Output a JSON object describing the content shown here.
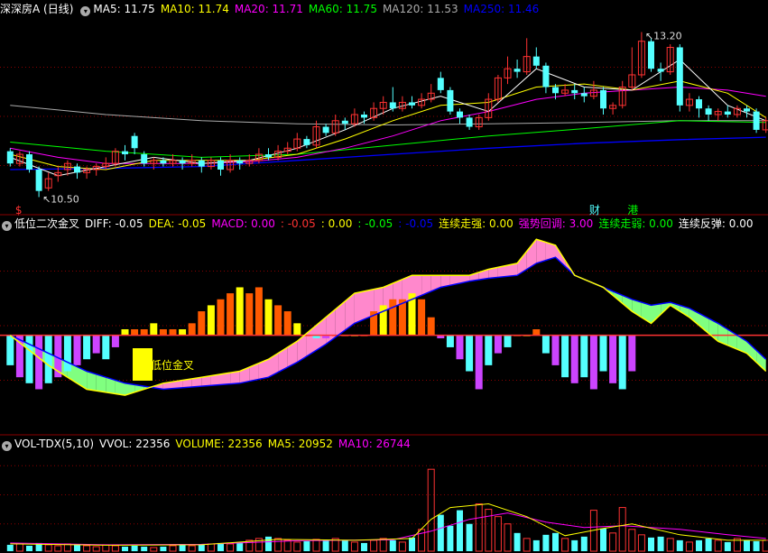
{
  "colors": {
    "bg": "#000000",
    "grid": "#8b0000",
    "up": "#ff3232",
    "down": "#54ffff",
    "ma5": "#ffffff",
    "ma10": "#ffff00",
    "ma20": "#ff00ff",
    "ma60": "#00ff00",
    "ma120": "#aaaaaa",
    "ma250": "#0000ff",
    "yellow": "#ffff00",
    "orange": "#ff5a00",
    "pink": "#ff88cc",
    "green": "#80ff80",
    "purple": "#cc44ff",
    "text_white": "#ffffff"
  },
  "panels": {
    "price": {
      "title": "深深房A (日线)",
      "indicators": [
        {
          "label": "MA5: 11.75",
          "color": "#ffffff"
        },
        {
          "label": "MA10: 11.74",
          "color": "#ffff00"
        },
        {
          "label": "MA20: 11.71",
          "color": "#ff00ff"
        },
        {
          "label": "MA60: 11.75",
          "color": "#00ff00"
        },
        {
          "label": "MA120: 11.53",
          "color": "#aaaaaa"
        },
        {
          "label": "MA250: 11.46",
          "color": "#0000ff"
        }
      ],
      "high_label": "13.20",
      "low_label": "10.50",
      "markers": [
        {
          "text": "$",
          "color": "#ff3232",
          "candle": 1
        },
        {
          "text": "财",
          "color": "#54ffff",
          "candle": 61
        },
        {
          "text": "港",
          "color": "#00ff00",
          "candle": 65
        }
      ]
    },
    "macd": {
      "title": "低位二次金叉",
      "indicators": [
        {
          "label": "DIFF: -0.05",
          "color": "#ffffff"
        },
        {
          "label": "DEA: -0.05",
          "color": "#ffff00"
        },
        {
          "label": "MACD: 0.00",
          "color": "#ff00ff"
        },
        {
          "label": ": -0.05",
          "color": "#ff3232"
        },
        {
          "label": ": 0.00",
          "color": "#ffff00"
        },
        {
          "label": ": -0.05",
          "color": "#00ff00"
        },
        {
          "label": ": -0.05",
          "color": "#0000ff"
        },
        {
          "label": "连续走强: 0.00",
          "color": "#ffff00"
        },
        {
          "label": "强势回调: 3.00",
          "color": "#ff00ff"
        },
        {
          "label": "连续走弱: 0.00",
          "color": "#00ff00"
        },
        {
          "label": "连续反弹: 0.00",
          "color": "#ffffff"
        }
      ],
      "annotation": "低位金叉"
    },
    "vol": {
      "title": "VOL-TDX(5,10)",
      "indicators": [
        {
          "label": "VVOL: 22356",
          "color": "#ffffff"
        },
        {
          "label": "VOLUME: 22356",
          "color": "#ffff00"
        },
        {
          "label": "MA5: 20952",
          "color": "#ffff00"
        },
        {
          "label": "MA10: 26744",
          "color": "#ff00ff"
        }
      ]
    }
  },
  "chart_data": {
    "type": "candlestick",
    "price_range": [
      10.3,
      13.4
    ],
    "candles": [
      [
        11.25,
        11.05,
        11.3,
        11.0
      ],
      [
        11.05,
        11.2,
        11.25,
        11.0
      ],
      [
        11.2,
        10.95,
        11.25,
        10.9
      ],
      [
        10.95,
        10.6,
        11.0,
        10.5
      ],
      [
        10.65,
        10.8,
        10.9,
        10.6
      ],
      [
        10.85,
        10.9,
        11.0,
        10.75
      ],
      [
        10.95,
        11.05,
        11.1,
        10.85
      ],
      [
        11.0,
        10.9,
        11.05,
        10.8
      ],
      [
        10.9,
        10.95,
        11.0,
        10.8
      ],
      [
        10.95,
        11.0,
        11.05,
        10.85
      ],
      [
        11.0,
        11.05,
        11.15,
        10.95
      ],
      [
        11.05,
        11.25,
        11.3,
        11.0
      ],
      [
        11.25,
        11.2,
        11.35,
        11.1
      ],
      [
        11.5,
        11.3,
        11.55,
        11.2
      ],
      [
        11.2,
        11.05,
        11.25,
        11.0
      ],
      [
        11.05,
        11.1,
        11.15,
        10.95
      ],
      [
        11.1,
        11.05,
        11.15,
        11.0
      ],
      [
        11.05,
        11.1,
        11.2,
        11.0
      ],
      [
        11.1,
        11.05,
        11.15,
        10.95
      ],
      [
        11.05,
        11.1,
        11.2,
        11.0
      ],
      [
        11.1,
        11.0,
        11.15,
        10.9
      ],
      [
        11.0,
        11.1,
        11.15,
        10.95
      ],
      [
        11.1,
        10.95,
        11.15,
        10.85
      ],
      [
        10.95,
        11.1,
        11.2,
        10.9
      ],
      [
        11.1,
        11.05,
        11.15,
        10.95
      ],
      [
        11.05,
        11.1,
        11.2,
        11.0
      ],
      [
        11.1,
        11.2,
        11.3,
        11.05
      ],
      [
        11.2,
        11.15,
        11.3,
        11.1
      ],
      [
        11.15,
        11.25,
        11.35,
        11.1
      ],
      [
        11.25,
        11.3,
        11.4,
        11.2
      ],
      [
        11.3,
        11.45,
        11.55,
        11.25
      ],
      [
        11.45,
        11.35,
        11.5,
        11.3
      ],
      [
        11.35,
        11.65,
        11.75,
        11.3
      ],
      [
        11.65,
        11.55,
        11.7,
        11.5
      ],
      [
        11.55,
        11.75,
        11.85,
        11.5
      ],
      [
        11.75,
        11.7,
        11.8,
        11.6
      ],
      [
        11.7,
        11.85,
        11.95,
        11.65
      ],
      [
        11.85,
        11.8,
        11.9,
        11.7
      ],
      [
        11.8,
        11.95,
        12.05,
        11.75
      ],
      [
        11.95,
        12.05,
        12.15,
        11.85
      ],
      [
        12.05,
        11.95,
        12.3,
        11.9
      ],
      [
        11.95,
        12.05,
        12.15,
        11.9
      ],
      [
        12.05,
        12.0,
        12.15,
        11.95
      ],
      [
        12.0,
        12.1,
        12.2,
        11.95
      ],
      [
        12.1,
        12.2,
        12.35,
        12.05
      ],
      [
        12.45,
        12.25,
        12.55,
        12.2
      ],
      [
        12.25,
        11.9,
        12.3,
        11.85
      ],
      [
        11.9,
        11.8,
        11.95,
        11.7
      ],
      [
        11.8,
        11.65,
        11.85,
        11.6
      ],
      [
        11.65,
        11.8,
        11.85,
        11.6
      ],
      [
        11.8,
        12.1,
        12.2,
        11.75
      ],
      [
        12.1,
        12.45,
        12.5,
        12.05
      ],
      [
        12.45,
        12.6,
        12.8,
        12.35
      ],
      [
        12.6,
        12.55,
        12.75,
        12.45
      ],
      [
        12.55,
        12.8,
        13.1,
        12.5
      ],
      [
        12.8,
        12.65,
        12.95,
        12.6
      ],
      [
        12.65,
        12.3,
        12.7,
        12.2
      ],
      [
        12.3,
        12.2,
        12.35,
        12.1
      ],
      [
        12.2,
        12.25,
        12.35,
        12.15
      ],
      [
        12.25,
        12.2,
        12.35,
        12.1
      ],
      [
        12.2,
        12.15,
        12.3,
        12.05
      ],
      [
        12.15,
        12.25,
        12.4,
        12.1
      ],
      [
        12.25,
        11.95,
        12.3,
        11.85
      ],
      [
        11.95,
        12.0,
        12.05,
        11.85
      ],
      [
        12.0,
        12.3,
        12.4,
        11.95
      ],
      [
        12.3,
        12.5,
        12.95,
        12.25
      ],
      [
        12.5,
        13.05,
        13.2,
        12.45
      ],
      [
        13.05,
        12.6,
        13.1,
        12.55
      ],
      [
        12.6,
        12.55,
        12.7,
        12.4
      ],
      [
        12.55,
        12.95,
        13.0,
        12.5
      ],
      [
        12.95,
        12.0,
        13.0,
        11.9
      ],
      [
        12.0,
        12.1,
        12.2,
        11.9
      ],
      [
        12.1,
        11.95,
        12.15,
        11.8
      ],
      [
        11.95,
        11.85,
        12.0,
        11.75
      ],
      [
        11.85,
        11.9,
        11.95,
        11.75
      ],
      [
        11.9,
        11.85,
        12.0,
        11.8
      ],
      [
        11.85,
        11.95,
        12.0,
        11.8
      ],
      [
        11.95,
        11.9,
        12.0,
        11.8
      ],
      [
        11.9,
        11.6,
        11.95,
        11.55
      ],
      [
        11.6,
        11.75,
        11.8,
        11.55
      ]
    ],
    "ma_lines": {
      "ma5": [
        [
          0,
          11.15
        ],
        [
          5,
          10.85
        ],
        [
          10,
          11.0
        ],
        [
          15,
          11.15
        ],
        [
          20,
          11.05
        ],
        [
          25,
          11.1
        ],
        [
          30,
          11.3
        ],
        [
          35,
          11.6
        ],
        [
          40,
          11.95
        ],
        [
          45,
          12.15
        ],
        [
          50,
          11.9
        ],
        [
          55,
          12.6
        ],
        [
          60,
          12.3
        ],
        [
          65,
          12.25
        ],
        [
          70,
          12.75
        ],
        [
          75,
          12.0
        ],
        [
          79,
          11.75
        ]
      ],
      "ma10": [
        [
          0,
          11.2
        ],
        [
          5,
          11.0
        ],
        [
          10,
          10.95
        ],
        [
          15,
          11.1
        ],
        [
          20,
          11.1
        ],
        [
          25,
          11.1
        ],
        [
          30,
          11.2
        ],
        [
          35,
          11.45
        ],
        [
          40,
          11.75
        ],
        [
          45,
          12.0
        ],
        [
          50,
          12.05
        ],
        [
          55,
          12.3
        ],
        [
          60,
          12.35
        ],
        [
          65,
          12.25
        ],
        [
          70,
          12.4
        ],
        [
          75,
          12.2
        ],
        [
          79,
          11.8
        ]
      ],
      "ma20": [
        [
          0,
          11.3
        ],
        [
          5,
          11.15
        ],
        [
          10,
          11.05
        ],
        [
          15,
          11.05
        ],
        [
          20,
          11.05
        ],
        [
          25,
          11.08
        ],
        [
          30,
          11.15
        ],
        [
          35,
          11.3
        ],
        [
          40,
          11.5
        ],
        [
          45,
          11.75
        ],
        [
          50,
          11.9
        ],
        [
          55,
          12.1
        ],
        [
          60,
          12.2
        ],
        [
          65,
          12.25
        ],
        [
          70,
          12.3
        ],
        [
          75,
          12.25
        ],
        [
          79,
          12.15
        ]
      ],
      "ma60": [
        [
          0,
          11.4
        ],
        [
          10,
          11.25
        ],
        [
          20,
          11.15
        ],
        [
          30,
          11.2
        ],
        [
          40,
          11.35
        ],
        [
          50,
          11.5
        ],
        [
          60,
          11.62
        ],
        [
          70,
          11.75
        ],
        [
          79,
          11.72
        ]
      ],
      "ma120": [
        [
          0,
          12.0
        ],
        [
          10,
          11.85
        ],
        [
          20,
          11.75
        ],
        [
          30,
          11.7
        ],
        [
          40,
          11.68
        ],
        [
          50,
          11.7
        ],
        [
          60,
          11.72
        ],
        [
          70,
          11.75
        ],
        [
          79,
          11.75
        ]
      ],
      "ma250": [
        [
          0,
          10.95
        ],
        [
          10,
          10.97
        ],
        [
          20,
          11.0
        ],
        [
          30,
          11.1
        ],
        [
          40,
          11.2
        ],
        [
          50,
          11.3
        ],
        [
          60,
          11.38
        ],
        [
          70,
          11.44
        ],
        [
          79,
          11.48
        ]
      ]
    },
    "macd": {
      "range": [
        -0.16,
        0.18
      ],
      "diff": [
        [
          0,
          0.0
        ],
        [
          4,
          -0.05
        ],
        [
          8,
          -0.09
        ],
        [
          12,
          -0.1
        ],
        [
          16,
          -0.08
        ],
        [
          20,
          -0.07
        ],
        [
          24,
          -0.06
        ],
        [
          27,
          -0.04
        ],
        [
          30,
          -0.01
        ],
        [
          33,
          0.03
        ],
        [
          36,
          0.07
        ],
        [
          39,
          0.08
        ],
        [
          42,
          0.1
        ],
        [
          45,
          0.1
        ],
        [
          48,
          0.1
        ],
        [
          50,
          0.11
        ],
        [
          53,
          0.12
        ],
        [
          55,
          0.16
        ],
        [
          57,
          0.15
        ],
        [
          59,
          0.1
        ],
        [
          62,
          0.08
        ],
        [
          65,
          0.04
        ],
        [
          67,
          0.02
        ],
        [
          69,
          0.05
        ],
        [
          71,
          0.03
        ],
        [
          74,
          -0.01
        ],
        [
          77,
          -0.03
        ],
        [
          79,
          -0.06
        ]
      ],
      "dea": [
        [
          0,
          0.0
        ],
        [
          4,
          -0.03
        ],
        [
          8,
          -0.06
        ],
        [
          12,
          -0.08
        ],
        [
          16,
          -0.09
        ],
        [
          20,
          -0.085
        ],
        [
          24,
          -0.08
        ],
        [
          27,
          -0.07
        ],
        [
          30,
          -0.045
        ],
        [
          33,
          -0.015
        ],
        [
          36,
          0.02
        ],
        [
          39,
          0.04
        ],
        [
          42,
          0.06
        ],
        [
          45,
          0.08
        ],
        [
          48,
          0.09
        ],
        [
          50,
          0.095
        ],
        [
          53,
          0.1
        ],
        [
          55,
          0.12
        ],
        [
          57,
          0.13
        ],
        [
          59,
          0.1
        ],
        [
          62,
          0.08
        ],
        [
          65,
          0.06
        ],
        [
          67,
          0.05
        ],
        [
          69,
          0.055
        ],
        [
          71,
          0.045
        ],
        [
          74,
          0.02
        ],
        [
          77,
          -0.01
        ],
        [
          79,
          -0.04
        ]
      ],
      "hist": [
        -0.05,
        -0.07,
        -0.08,
        -0.09,
        -0.08,
        -0.07,
        -0.06,
        -0.05,
        -0.04,
        -0.03,
        -0.04,
        -0.02,
        0.01,
        0.01,
        0.01,
        0.02,
        0.01,
        0.01,
        0.01,
        0.02,
        0.04,
        0.05,
        0.06,
        0.07,
        0.08,
        0.07,
        0.08,
        0.06,
        0.05,
        0.04,
        0.02,
        0.0,
        -0.005,
        -0.005,
        0.0,
        0.0,
        0.0,
        0.0,
        0.04,
        0.05,
        0.06,
        0.06,
        0.07,
        0.06,
        0.03,
        -0.005,
        -0.02,
        -0.04,
        -0.06,
        -0.09,
        -0.05,
        -0.03,
        -0.02,
        0.0,
        0.0,
        0.01,
        -0.03,
        -0.05,
        -0.07,
        -0.08,
        -0.07,
        -0.09,
        -0.06,
        -0.08,
        -0.09,
        -0.06
      ],
      "hist_start": 0
    },
    "volume": {
      "range": [
        0,
        110000
      ],
      "values": [
        7000,
        8000,
        6000,
        9000,
        7000,
        6000,
        8000,
        7000,
        6000,
        5000,
        7000,
        6000,
        5000,
        6000,
        5000,
        4000,
        5000,
        6000,
        7000,
        6000,
        7000,
        8000,
        9000,
        8000,
        10000,
        12000,
        14000,
        16000,
        14000,
        12000,
        10000,
        11000,
        13000,
        12000,
        14000,
        12000,
        10000,
        9000,
        12000,
        14000,
        12000,
        10000,
        15000,
        24000,
        90000,
        40000,
        28000,
        45000,
        30000,
        52000,
        46000,
        38000,
        30000,
        20000,
        14000,
        12000,
        18000,
        20000,
        14000,
        12000,
        16000,
        45000,
        25000,
        20000,
        48000,
        24000,
        18000,
        15000,
        16000,
        14000,
        12000,
        10000,
        12000,
        14000,
        12000,
        10000,
        14000,
        12000,
        11000,
        12000
      ],
      "ma5": [
        [
          0,
          8000
        ],
        [
          10,
          6500
        ],
        [
          20,
          7000
        ],
        [
          28,
          13000
        ],
        [
          36,
          12000
        ],
        [
          42,
          14000
        ],
        [
          44,
          35000
        ],
        [
          46,
          48000
        ],
        [
          50,
          52000
        ],
        [
          54,
          38000
        ],
        [
          58,
          17000
        ],
        [
          62,
          25000
        ],
        [
          65,
          30000
        ],
        [
          70,
          18000
        ],
        [
          75,
          12000
        ],
        [
          79,
          12000
        ]
      ],
      "ma10": [
        [
          0,
          9000
        ],
        [
          10,
          7000
        ],
        [
          20,
          7500
        ],
        [
          30,
          11500
        ],
        [
          40,
          12500
        ],
        [
          44,
          22000
        ],
        [
          48,
          35000
        ],
        [
          52,
          42000
        ],
        [
          56,
          32000
        ],
        [
          60,
          26000
        ],
        [
          64,
          28000
        ],
        [
          70,
          24000
        ],
        [
          75,
          18000
        ],
        [
          79,
          14000
        ]
      ]
    }
  }
}
